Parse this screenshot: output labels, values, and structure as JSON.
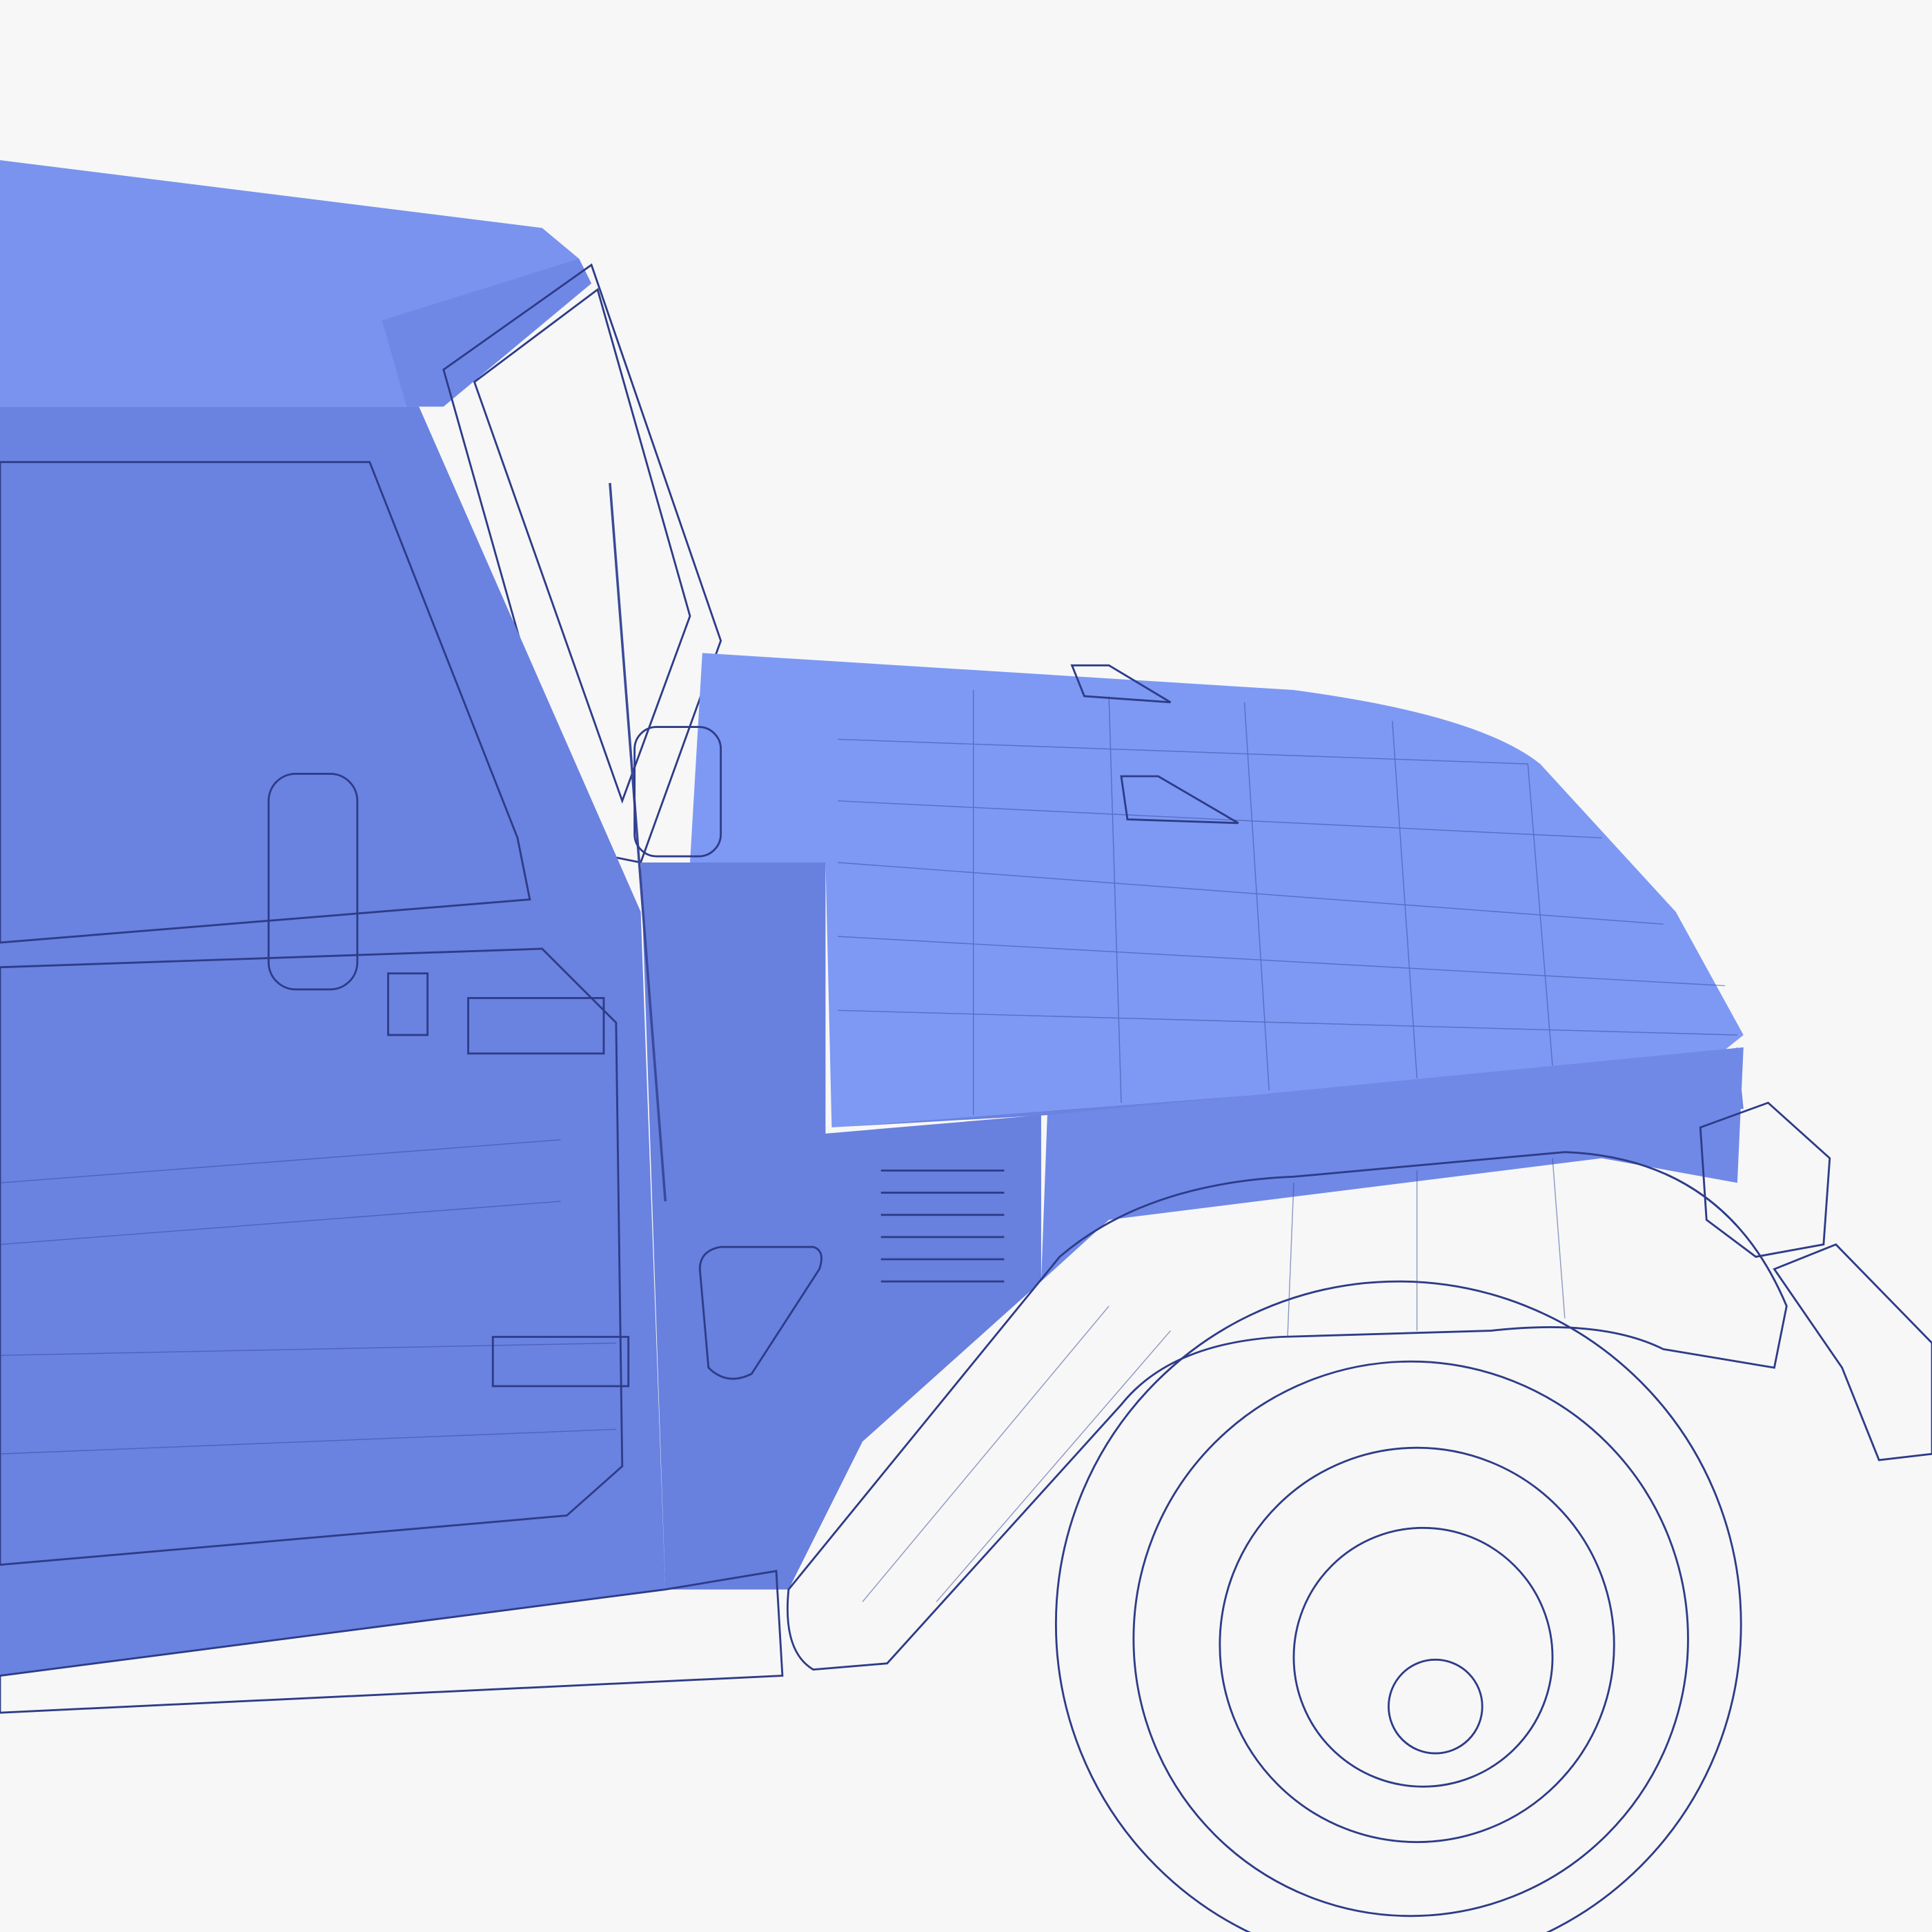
{
  "scene": {
    "subject": "vehicle-wireframe-render",
    "colors": {
      "background": "#f7f7f7",
      "body_light": "#7f9bf5",
      "body_mid": "#6f86e6",
      "body_dark": "#5a6fcf",
      "wire": "#3a4a9a"
    }
  }
}
